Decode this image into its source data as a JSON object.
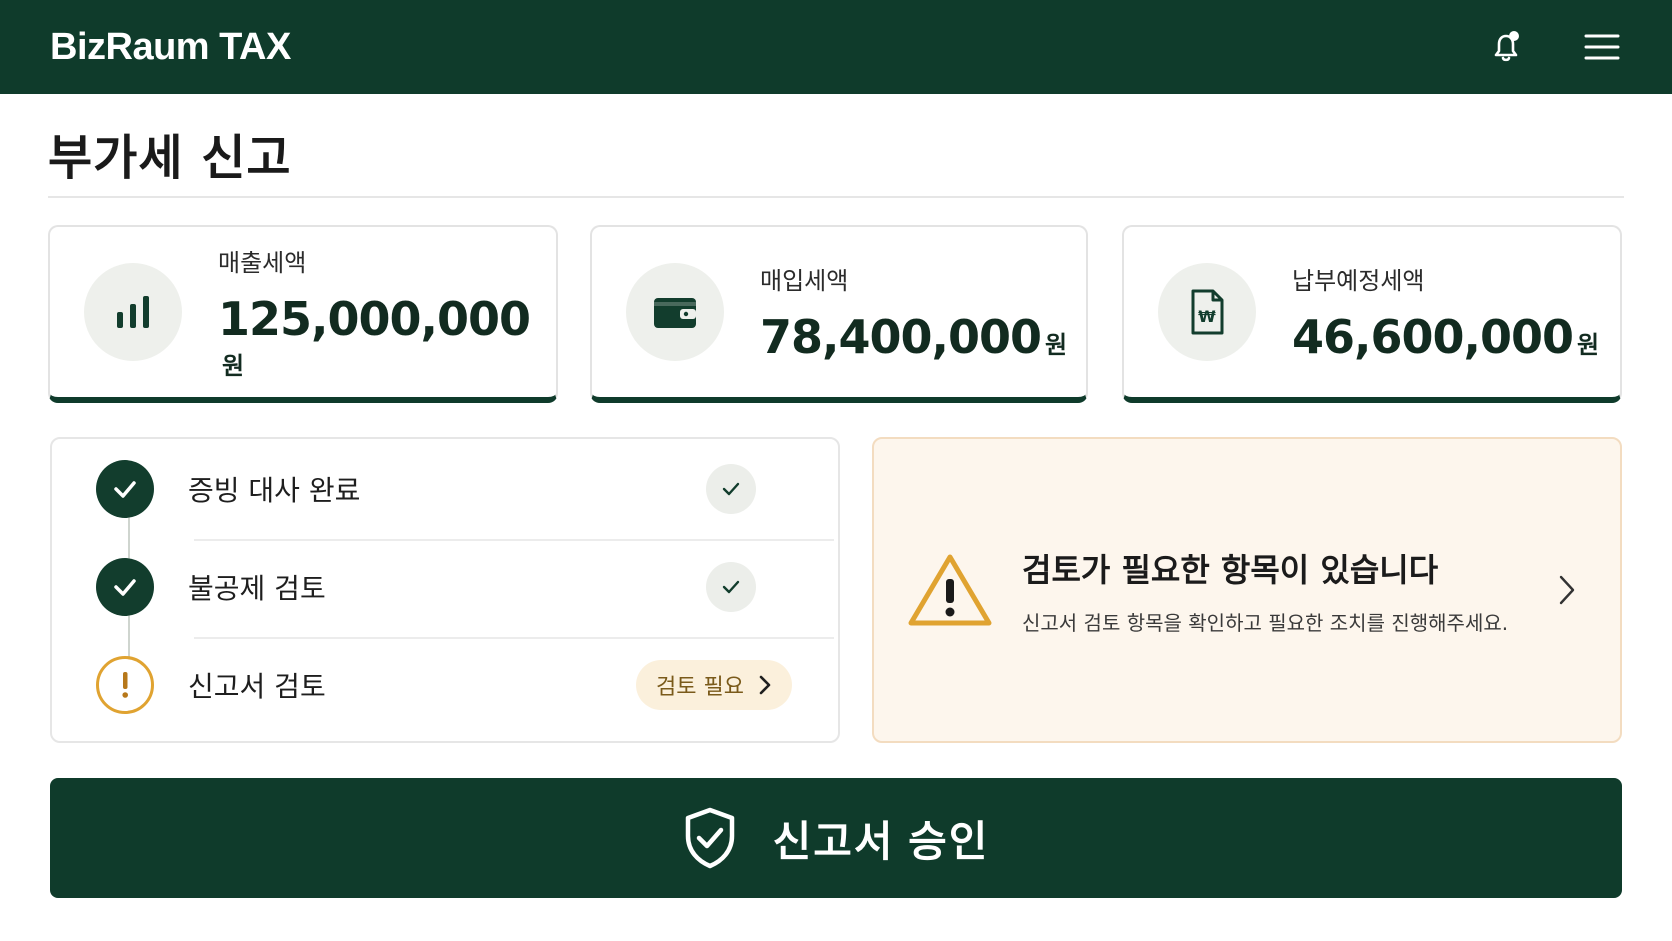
{
  "app": {
    "brand": "BizRaum TAX"
  },
  "page": {
    "title": "부가세 신고"
  },
  "stats": [
    {
      "label": "매출세액",
      "value": "125,000,000",
      "unit": "원",
      "icon": "bar-chart-icon"
    },
    {
      "label": "매입세액",
      "value": "78,400,000",
      "unit": "원",
      "icon": "wallet-icon"
    },
    {
      "label": "납부예정세액",
      "value": "46,600,000",
      "unit": "원",
      "icon": "won-document-icon"
    }
  ],
  "checklist": {
    "steps": [
      {
        "label": "증빙 대사 완료",
        "status": "done"
      },
      {
        "label": "불공제 검토",
        "status": "done"
      },
      {
        "label": "신고서 검토",
        "status": "needs-review",
        "badge": "검토 필요"
      }
    ]
  },
  "alert": {
    "title": "검토가 필요한 항목이 있습니다",
    "description": "신고서 검토 항목을 확인하고 필요한 조치를 진행해주세요."
  },
  "actions": {
    "approve_label": "신고서 승인"
  },
  "colors": {
    "primary": "#0f3b2b",
    "warning": "#e0a331",
    "alert_bg": "#fdf6ed"
  }
}
